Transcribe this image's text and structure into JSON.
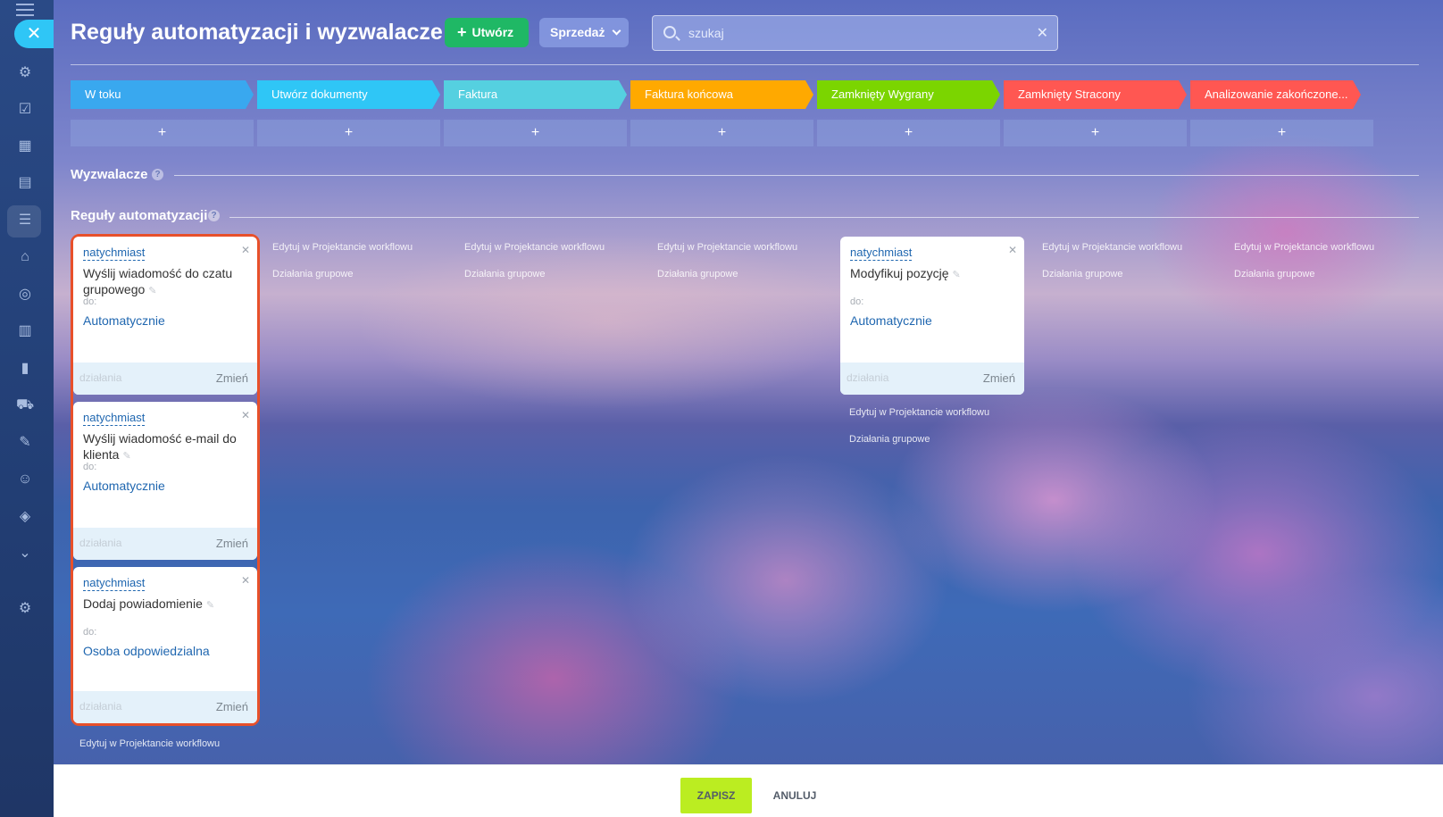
{
  "header": {
    "title": "Reguły automatyzacji i wyzwalacze",
    "create_label": "Utwórz",
    "category_label": "Sprzedaż",
    "search_placeholder": "szukaj"
  },
  "stages": [
    {
      "label": "W toku",
      "color": "#39a8ef"
    },
    {
      "label": "Utwórz dokumenty",
      "color": "#2fc6f6"
    },
    {
      "label": "Faktura",
      "color": "#55d0e0"
    },
    {
      "label": "Faktura końcowa",
      "color": "#ffa900"
    },
    {
      "label": "Zamknięty Wygrany",
      "color": "#7bd500"
    },
    {
      "label": "Zamknięty Stracony",
      "color": "#ff5752"
    },
    {
      "label": "Analizowanie zakończone...",
      "color": "#ff5752"
    }
  ],
  "add_symbol": "+",
  "sections": {
    "triggers": "Wyzwalacze",
    "rules": "Reguły automatyzacji",
    "help": "?"
  },
  "cards": {
    "c1": {
      "when": "natychmiast",
      "name": "Wyślij wiadomość do czatu grupowego",
      "to_label": "do:",
      "to_value": "Automatycznie",
      "actions": "działania",
      "change": "Zmień"
    },
    "c2": {
      "when": "natychmiast",
      "name": "Wyślij wiadomość e-mail do klienta",
      "to_label": "do:",
      "to_value": "Automatycznie",
      "actions": "działania",
      "change": "Zmień"
    },
    "c3": {
      "when": "natychmiast",
      "name": "Dodaj powiadomienie",
      "to_label": "do:",
      "to_value": "Osoba odpowiedzialna",
      "actions": "działania",
      "change": "Zmień"
    },
    "c4": {
      "when": "natychmiast",
      "name": "Modyfikuj pozycję",
      "to_label": "do:",
      "to_value": "Automatycznie",
      "actions": "działania",
      "change": "Zmień"
    }
  },
  "links": {
    "edit_designer": "Edytuj w Projektancie workflowu",
    "group_actions": "Działania grupowe"
  },
  "footer": {
    "save": "ZAPISZ",
    "cancel": "ANULUJ"
  }
}
